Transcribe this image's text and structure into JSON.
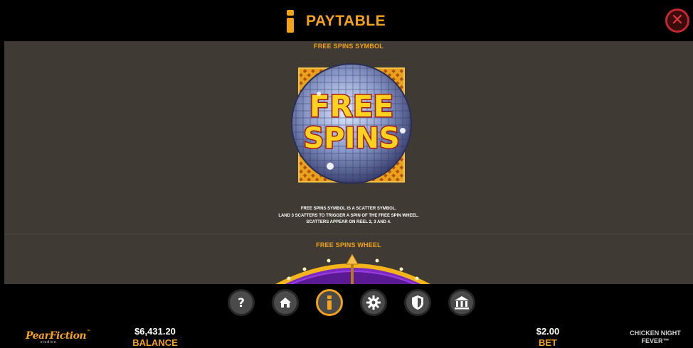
{
  "header": {
    "title": "PAYTABLE",
    "close_icon": "close-icon",
    "info_icon": "info-icon",
    "accent": "#f3a21a"
  },
  "content": {
    "symbol_section_title": "FREE SPINS SYMBOL",
    "symbol_text_line1": "FREE",
    "symbol_text_line2": "SPINS",
    "description": [
      "FREE SPINS SYMBOL IS A SCATTER SYMBOL.",
      "LAND 3 SCATTERS TO TRIGGER A SPIN OF THE FREE SPIN WHEEL.",
      "SCATTERS APPEAR ON REEL 2, 3 AND 4."
    ],
    "wheel_section_title": "FREE SPINS WHEEL"
  },
  "nav": {
    "buttons": [
      {
        "icon": "help-icon",
        "glyph": "?"
      },
      {
        "icon": "home-icon"
      },
      {
        "icon": "info-icon",
        "active": true
      },
      {
        "icon": "settings-icon"
      },
      {
        "icon": "shield-icon"
      },
      {
        "icon": "bank-icon"
      }
    ]
  },
  "footer": {
    "logo_main": "PearFiction",
    "logo_sub": "studios",
    "logo_tm": "™",
    "balance_value": "$6,431.20",
    "balance_label": "BALANCE",
    "bet_value": "$2.00",
    "bet_label": "BET",
    "game_name_line1": "CHICKEN NIGHT",
    "game_name_line2": "FEVER™"
  }
}
